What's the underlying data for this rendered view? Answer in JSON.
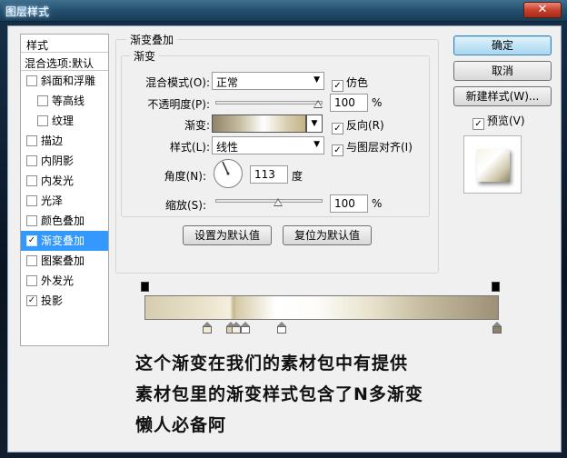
{
  "window": {
    "title": "图层样式",
    "close_glyph": "✕"
  },
  "style_list": {
    "header": "样式",
    "blend_options": "混合选项:默认",
    "items": [
      {
        "label": "斜面和浮雕",
        "checked": false,
        "sub": false
      },
      {
        "label": "等高线",
        "checked": false,
        "sub": true
      },
      {
        "label": "纹理",
        "checked": false,
        "sub": true
      },
      {
        "label": "描边",
        "checked": false,
        "sub": false
      },
      {
        "label": "内阴影",
        "checked": false,
        "sub": false
      },
      {
        "label": "内发光",
        "checked": false,
        "sub": false
      },
      {
        "label": "光泽",
        "checked": false,
        "sub": false
      },
      {
        "label": "颜色叠加",
        "checked": false,
        "sub": false
      },
      {
        "label": "渐变叠加",
        "checked": true,
        "sub": false,
        "active": true
      },
      {
        "label": "图案叠加",
        "checked": false,
        "sub": false
      },
      {
        "label": "外发光",
        "checked": false,
        "sub": false
      },
      {
        "label": "投影",
        "checked": true,
        "sub": false
      }
    ]
  },
  "panel": {
    "outer_title": "渐变叠加",
    "inner_title": "渐变",
    "blend_mode_label": "混合模式(O):",
    "blend_mode_value": "正常",
    "dither_label": "仿色",
    "opacity_label": "不透明度(P):",
    "opacity_value": "100",
    "gradient_label": "渐变:",
    "reverse_label": "反向(R)",
    "style_label": "样式(L):",
    "style_value": "线性",
    "align_label": "与图层对齐(I)",
    "angle_label": "角度(N):",
    "angle_value": "113",
    "angle_unit": "度",
    "scale_label": "缩放(S):",
    "scale_value": "100",
    "percent": "%",
    "set_default_btn": "设置为默认值",
    "reset_default_btn": "复位为默认值"
  },
  "buttons": {
    "ok": "确定",
    "cancel": "取消",
    "new_style": "新建样式(W)...",
    "preview_label": "预览(V)"
  },
  "check_glyph": "✓",
  "note_lines": [
    "这个渐变在我们的素材包中有提供",
    "素材包里的渐变样式包含了N多渐变",
    "懒人必备阿"
  ],
  "colors": {
    "accent": "#3399ff",
    "gradient_start": "#d6cdb0",
    "gradient_end": "#9d9077"
  }
}
